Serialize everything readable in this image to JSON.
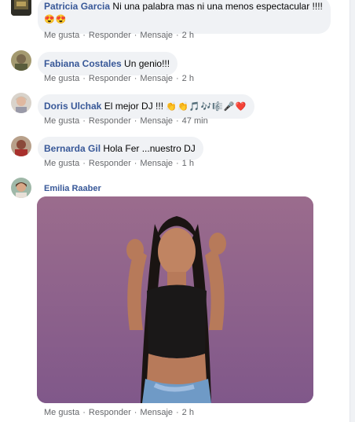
{
  "comments": [
    {
      "author": "Patricia Garcia",
      "text": "Ni una palabra mas ni una menos espectacular !!!!",
      "emojis": [
        "😍",
        "😍"
      ],
      "actions": {
        "like": "Me gusta",
        "reply": "Responder",
        "message": "Mensaje",
        "time": "2 h"
      }
    },
    {
      "author": "Fabiana Costales",
      "text": "Un genio!!!",
      "actions": {
        "like": "Me gusta",
        "reply": "Responder",
        "message": "Mensaje",
        "time": "2 h"
      }
    },
    {
      "author": "Doris Ulchak",
      "text": "El mejor DJ !!!",
      "emojis": [
        "👏",
        "👏",
        "🎵",
        "🎶",
        "🎼",
        "🎤",
        "❤️"
      ],
      "actions": {
        "like": "Me gusta",
        "reply": "Responder",
        "message": "Mensaje",
        "time": "47 min"
      }
    },
    {
      "author": "Bernarda Gil",
      "text": "Hola Fer ...nuestro DJ",
      "actions": {
        "like": "Me gusta",
        "reply": "Responder",
        "message": "Mensaje",
        "time": "1 h"
      }
    },
    {
      "author": "Emilia Raaber",
      "actions": {
        "like": "Me gusta",
        "reply": "Responder",
        "message": "Mensaje",
        "time": "2 h"
      }
    }
  ],
  "colors": {
    "author": "#385898",
    "bubble": "#f0f2f5",
    "meta": "#65676b",
    "photo_bg": "#8c5f86"
  }
}
